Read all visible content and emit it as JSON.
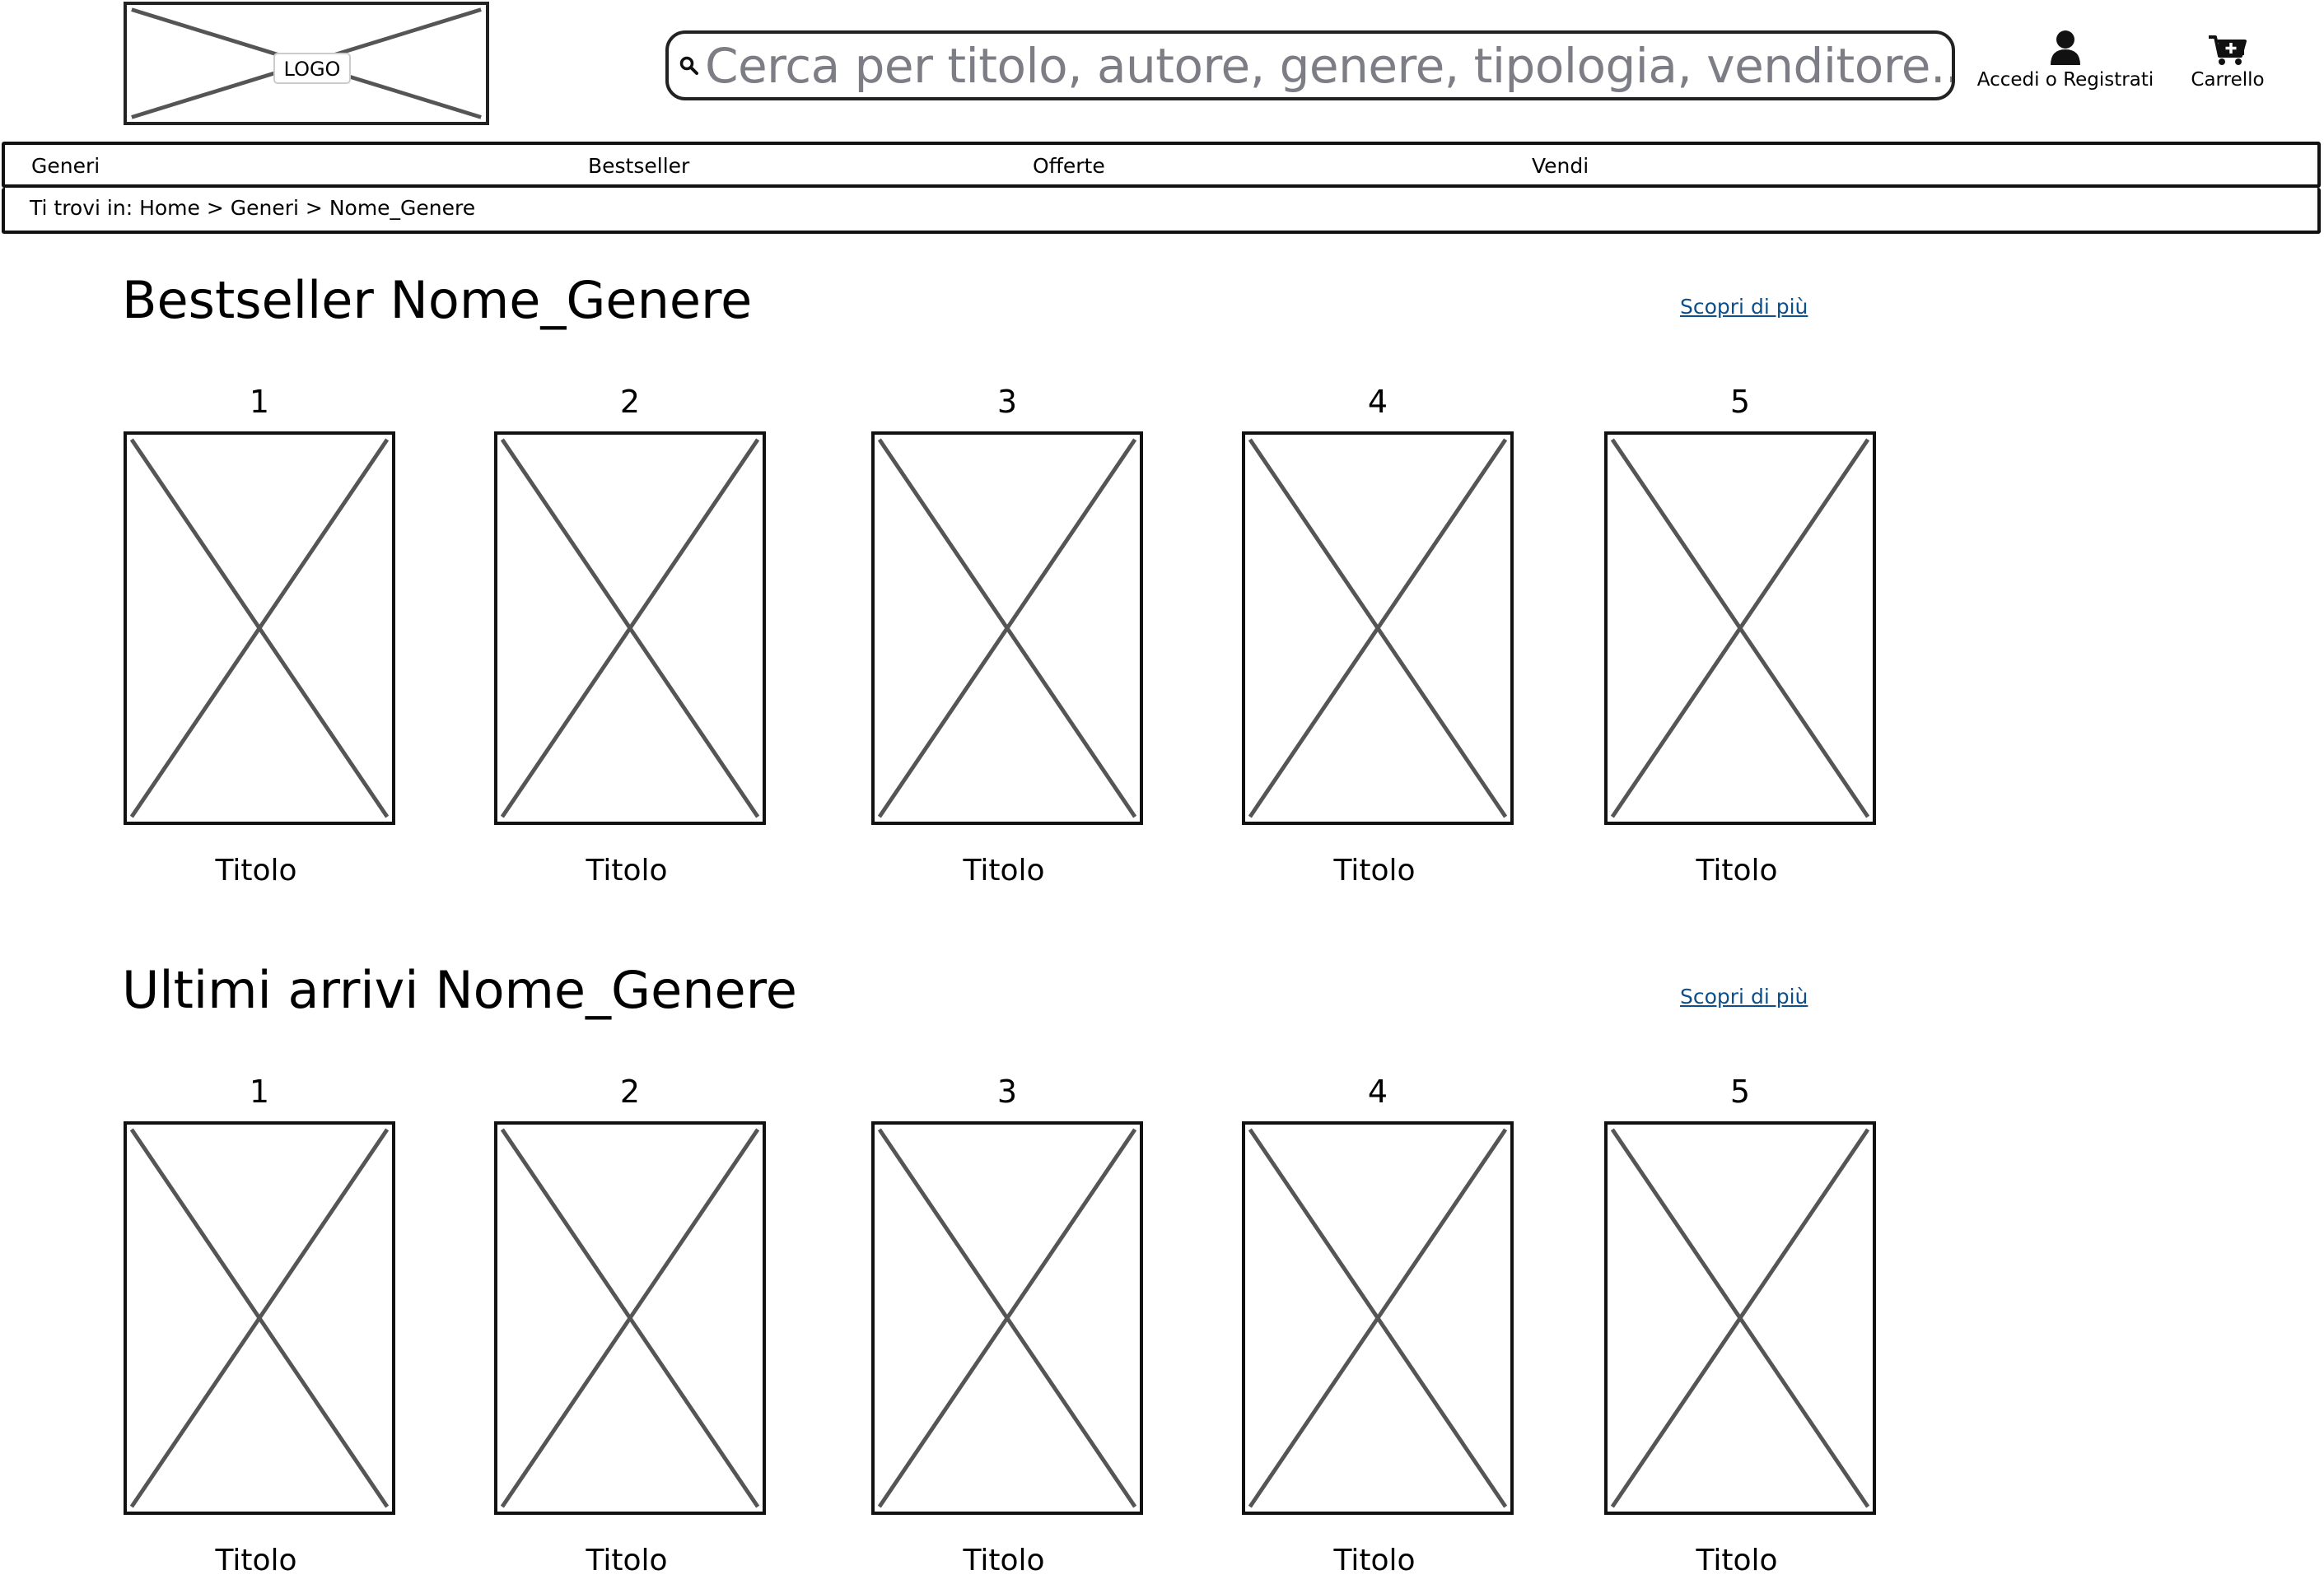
{
  "header": {
    "logo_text": "LOGO",
    "search": {
      "placeholder": "Cerca per titolo, autore, genere, tipologia, venditore...",
      "icon": "search-icon"
    },
    "account": {
      "label": "Accedi o Registrati",
      "icon": "user-icon"
    },
    "cart": {
      "label": "Carrello",
      "icon": "cart-add-icon"
    }
  },
  "nav": {
    "items": [
      {
        "label": "Generi"
      },
      {
        "label": "Bestseller"
      },
      {
        "label": "Offerte"
      },
      {
        "label": "Vendi"
      }
    ]
  },
  "breadcrumb": {
    "prefix": "Ti trovi in:",
    "items": [
      "Home",
      "Generi",
      "Nome_Genere"
    ],
    "separator": ">"
  },
  "sections": [
    {
      "title": "Bestseller Nome_Genere",
      "more_label": "Scopri di più",
      "books": [
        {
          "rank": "1",
          "title": "Titolo"
        },
        {
          "rank": "2",
          "title": "Titolo"
        },
        {
          "rank": "3",
          "title": "Titolo"
        },
        {
          "rank": "4",
          "title": "Titolo"
        },
        {
          "rank": "5",
          "title": "Titolo"
        }
      ]
    },
    {
      "title": "Ultimi arrivi Nome_Genere",
      "more_label": "Scopri di più",
      "books": [
        {
          "rank": "1",
          "title": "Titolo"
        },
        {
          "rank": "2",
          "title": "Titolo"
        },
        {
          "rank": "3",
          "title": "Titolo"
        },
        {
          "rank": "4",
          "title": "Titolo"
        },
        {
          "rank": "5",
          "title": "Titolo"
        }
      ]
    }
  ]
}
